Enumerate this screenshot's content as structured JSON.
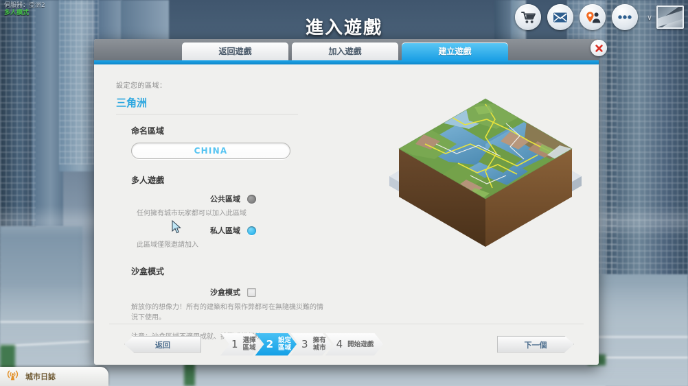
{
  "topbar": {
    "server_line": "伺服器：亞洲2",
    "mode_line": "多人模式",
    "title": "進入遊戲",
    "icons": [
      {
        "name": "shop-cart-icon",
        "label": "商店"
      },
      {
        "name": "mail-envelope-icon",
        "label": "訊息"
      },
      {
        "name": "friends-icon",
        "label": "好友"
      },
      {
        "name": "more-options-icon",
        "label": "更多"
      }
    ],
    "avatar_chevron": "∨"
  },
  "panel": {
    "tabs": [
      {
        "label": "返回遊戲",
        "active": false
      },
      {
        "label": "加入遊戲",
        "active": false
      },
      {
        "label": "建立遊戲",
        "active": true
      }
    ],
    "close_label": "✖",
    "setup_label": "設定您的區域：",
    "region_name": "三角洲",
    "name_section": {
      "heading": "命名區域",
      "value": "CHINA",
      "placeholder": "CHINA"
    },
    "multiplayer_section": {
      "heading": "多人遊戲",
      "public": {
        "label": "公共區域",
        "selected": false,
        "description": "任何擁有城市玩家都可以加入此區域"
      },
      "private": {
        "label": "私人區域",
        "selected": true,
        "description": "此區域僅限邀請加入"
      }
    },
    "sandbox_section": {
      "heading": "沙盒模式",
      "label": "沙盒模式",
      "checked": false,
      "description": "解放你的想像力！所有的建築和有限作弊都可在無隨機災難的情況下使用。",
      "note": "注意：沙盒區域不適用成就、挑戰或排行榜。"
    },
    "footer": {
      "back_label": "返回",
      "next_label": "下一個",
      "steps": [
        {
          "num": "1",
          "line1": "選擇",
          "line2": "區域",
          "active": false
        },
        {
          "num": "2",
          "line1": "設定",
          "line2": "區域",
          "active": true
        },
        {
          "num": "3",
          "line1": "擁有",
          "line2": "城市",
          "active": false
        },
        {
          "num": "4",
          "line1": "開始遊戲",
          "line2": "",
          "active": false
        }
      ]
    }
  },
  "citylog": {
    "label": "城市日誌",
    "icon": "broadcast-icon"
  },
  "colors": {
    "accent_blue": "#1fa5e8",
    "tab_active": "#29b0ec",
    "region_title": "#2fa8e0",
    "input_text": "#56c4f2",
    "mode_green": "#46c04a",
    "close_red": "#d93025"
  }
}
